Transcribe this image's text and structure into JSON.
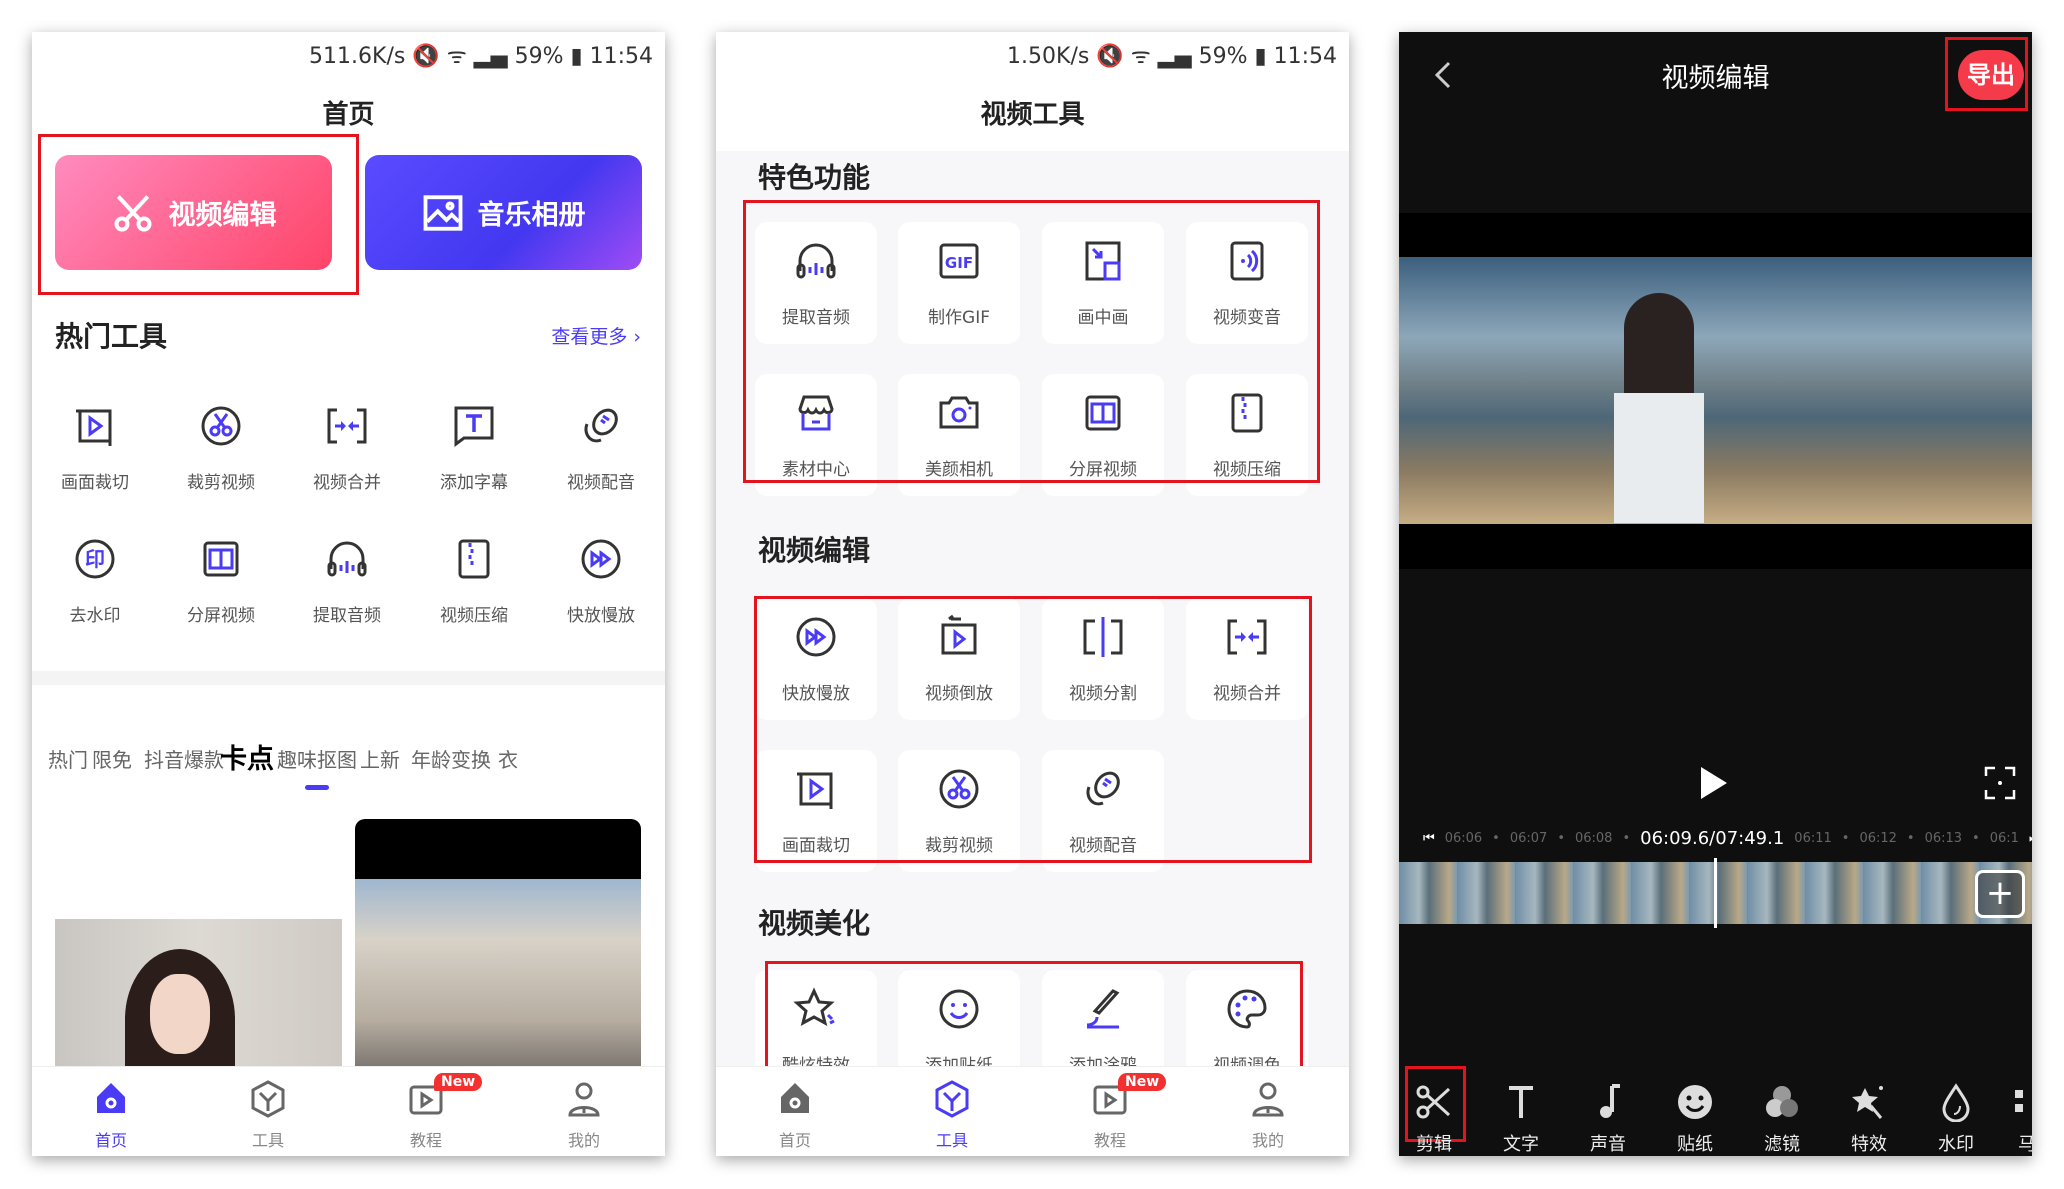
{
  "colors": {
    "accent": "#4a3cf5",
    "highlight": "#e3141e",
    "pink": "#ff4f7a",
    "badge": "#f23030"
  },
  "home": {
    "status": "511.6K/s  🔇 ᯤ ▂▄ 59% ▮ 11:54",
    "title": "首页",
    "banners": [
      {
        "label": "视频编辑",
        "icon": "scissors-icon"
      },
      {
        "label": "音乐相册",
        "icon": "image-icon"
      }
    ],
    "hot_tools_title": "热门工具",
    "see_more": "查看更多 ›",
    "tools": [
      {
        "label": "画面裁切",
        "icon": "crop-play-icon"
      },
      {
        "label": "裁剪视频",
        "icon": "cut-video-icon"
      },
      {
        "label": "视频合并",
        "icon": "merge-icon"
      },
      {
        "label": "添加字幕",
        "icon": "subtitle-icon"
      },
      {
        "label": "视频配音",
        "icon": "microphone-icon"
      },
      {
        "label": "去水印",
        "icon": "watermark-remove-icon"
      },
      {
        "label": "分屏视频",
        "icon": "split-screen-icon"
      },
      {
        "label": "提取音频",
        "icon": "headphones-icon"
      },
      {
        "label": "视频压缩",
        "icon": "zip-icon"
      },
      {
        "label": "快放慢放",
        "icon": "fast-forward-icon"
      }
    ],
    "tabs": [
      "热门",
      "限免",
      "抖音爆款",
      "卡点",
      "趣味抠图",
      "上新",
      "年龄变换",
      "衣"
    ],
    "active_tab": "卡点"
  },
  "tools_page": {
    "status": "1.50K/s  🔇 ᯤ ▂▄ 59% ▮ 11:54",
    "title": "视频工具",
    "sections": [
      {
        "title": "特色功能",
        "items": [
          {
            "label": "提取音频",
            "icon": "headphones-icon"
          },
          {
            "label": "制作GIF",
            "icon": "gif-icon"
          },
          {
            "label": "画中画",
            "icon": "picture-in-picture-icon"
          },
          {
            "label": "视频变音",
            "icon": "voice-change-icon"
          },
          {
            "label": "素材中心",
            "icon": "store-icon"
          },
          {
            "label": "美颜相机",
            "icon": "camera-icon"
          },
          {
            "label": "分屏视频",
            "icon": "split-screen-icon"
          },
          {
            "label": "视频压缩",
            "icon": "zip-icon"
          }
        ]
      },
      {
        "title": "视频编辑",
        "items": [
          {
            "label": "快放慢放",
            "icon": "fast-forward-icon"
          },
          {
            "label": "视频倒放",
            "icon": "reverse-icon"
          },
          {
            "label": "视频分割",
            "icon": "split-icon"
          },
          {
            "label": "视频合并",
            "icon": "merge-icon"
          },
          {
            "label": "画面裁切",
            "icon": "crop-play-icon"
          },
          {
            "label": "裁剪视频",
            "icon": "cut-video-icon"
          },
          {
            "label": "视频配音",
            "icon": "microphone-icon"
          }
        ]
      },
      {
        "title": "视频美化",
        "items": [
          {
            "label": "酷炫特效",
            "icon": "star-effect-icon"
          },
          {
            "label": "添加贴纸",
            "icon": "sticker-icon"
          },
          {
            "label": "添加涂鸦",
            "icon": "brush-icon"
          },
          {
            "label": "视频调色",
            "icon": "palette-icon"
          }
        ]
      }
    ]
  },
  "nav": {
    "items": [
      {
        "label": "首页",
        "icon": "home-icon"
      },
      {
        "label": "工具",
        "icon": "tools-icon"
      },
      {
        "label": "教程",
        "icon": "tutorial-icon"
      },
      {
        "label": "我的",
        "icon": "profile-icon"
      }
    ],
    "badge": "New"
  },
  "editor": {
    "title": "视频编辑",
    "export": "导出",
    "time": "06:09.6/07:49.1",
    "ticks_left": [
      "06:06",
      "06:07",
      "06:08"
    ],
    "ticks_right": [
      "06:11",
      "06:12",
      "06:13",
      "06:1"
    ],
    "tools": [
      {
        "label": "剪辑",
        "icon": "scissors-icon"
      },
      {
        "label": "文字",
        "icon": "text-icon"
      },
      {
        "label": "声音",
        "icon": "music-note-icon"
      },
      {
        "label": "贴纸",
        "icon": "smiley-icon"
      },
      {
        "label": "滤镜",
        "icon": "filter-icon"
      },
      {
        "label": "特效",
        "icon": "magic-star-icon"
      },
      {
        "label": "水印",
        "icon": "drop-icon"
      },
      {
        "label": "马",
        "icon": "mosaic-icon"
      }
    ]
  }
}
